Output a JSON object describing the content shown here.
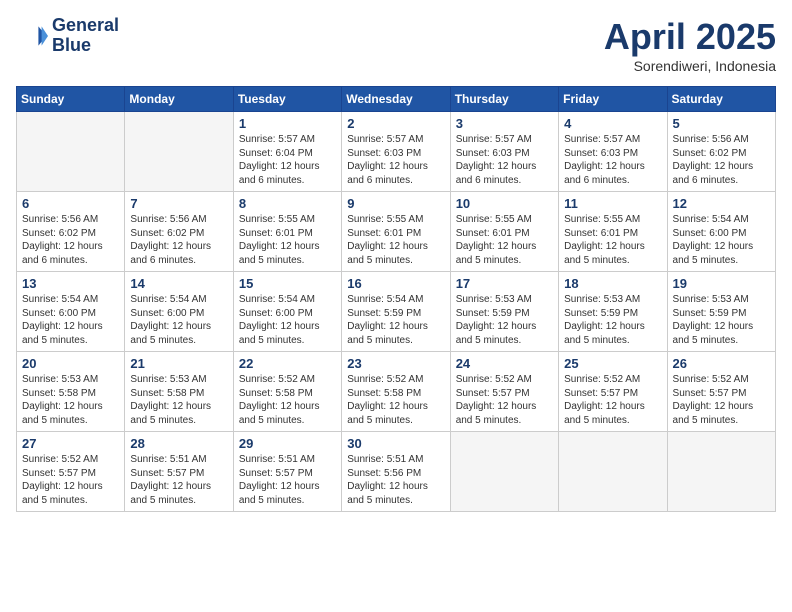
{
  "header": {
    "logo_line1": "General",
    "logo_line2": "Blue",
    "month": "April 2025",
    "location": "Sorendiweri, Indonesia"
  },
  "days_of_week": [
    "Sunday",
    "Monday",
    "Tuesday",
    "Wednesday",
    "Thursday",
    "Friday",
    "Saturday"
  ],
  "weeks": [
    [
      {
        "num": "",
        "info": ""
      },
      {
        "num": "",
        "info": ""
      },
      {
        "num": "1",
        "info": "Sunrise: 5:57 AM\nSunset: 6:04 PM\nDaylight: 12 hours\nand 6 minutes."
      },
      {
        "num": "2",
        "info": "Sunrise: 5:57 AM\nSunset: 6:03 PM\nDaylight: 12 hours\nand 6 minutes."
      },
      {
        "num": "3",
        "info": "Sunrise: 5:57 AM\nSunset: 6:03 PM\nDaylight: 12 hours\nand 6 minutes."
      },
      {
        "num": "4",
        "info": "Sunrise: 5:57 AM\nSunset: 6:03 PM\nDaylight: 12 hours\nand 6 minutes."
      },
      {
        "num": "5",
        "info": "Sunrise: 5:56 AM\nSunset: 6:02 PM\nDaylight: 12 hours\nand 6 minutes."
      }
    ],
    [
      {
        "num": "6",
        "info": "Sunrise: 5:56 AM\nSunset: 6:02 PM\nDaylight: 12 hours\nand 6 minutes."
      },
      {
        "num": "7",
        "info": "Sunrise: 5:56 AM\nSunset: 6:02 PM\nDaylight: 12 hours\nand 6 minutes."
      },
      {
        "num": "8",
        "info": "Sunrise: 5:55 AM\nSunset: 6:01 PM\nDaylight: 12 hours\nand 5 minutes."
      },
      {
        "num": "9",
        "info": "Sunrise: 5:55 AM\nSunset: 6:01 PM\nDaylight: 12 hours\nand 5 minutes."
      },
      {
        "num": "10",
        "info": "Sunrise: 5:55 AM\nSunset: 6:01 PM\nDaylight: 12 hours\nand 5 minutes."
      },
      {
        "num": "11",
        "info": "Sunrise: 5:55 AM\nSunset: 6:01 PM\nDaylight: 12 hours\nand 5 minutes."
      },
      {
        "num": "12",
        "info": "Sunrise: 5:54 AM\nSunset: 6:00 PM\nDaylight: 12 hours\nand 5 minutes."
      }
    ],
    [
      {
        "num": "13",
        "info": "Sunrise: 5:54 AM\nSunset: 6:00 PM\nDaylight: 12 hours\nand 5 minutes."
      },
      {
        "num": "14",
        "info": "Sunrise: 5:54 AM\nSunset: 6:00 PM\nDaylight: 12 hours\nand 5 minutes."
      },
      {
        "num": "15",
        "info": "Sunrise: 5:54 AM\nSunset: 6:00 PM\nDaylight: 12 hours\nand 5 minutes."
      },
      {
        "num": "16",
        "info": "Sunrise: 5:54 AM\nSunset: 5:59 PM\nDaylight: 12 hours\nand 5 minutes."
      },
      {
        "num": "17",
        "info": "Sunrise: 5:53 AM\nSunset: 5:59 PM\nDaylight: 12 hours\nand 5 minutes."
      },
      {
        "num": "18",
        "info": "Sunrise: 5:53 AM\nSunset: 5:59 PM\nDaylight: 12 hours\nand 5 minutes."
      },
      {
        "num": "19",
        "info": "Sunrise: 5:53 AM\nSunset: 5:59 PM\nDaylight: 12 hours\nand 5 minutes."
      }
    ],
    [
      {
        "num": "20",
        "info": "Sunrise: 5:53 AM\nSunset: 5:58 PM\nDaylight: 12 hours\nand 5 minutes."
      },
      {
        "num": "21",
        "info": "Sunrise: 5:53 AM\nSunset: 5:58 PM\nDaylight: 12 hours\nand 5 minutes."
      },
      {
        "num": "22",
        "info": "Sunrise: 5:52 AM\nSunset: 5:58 PM\nDaylight: 12 hours\nand 5 minutes."
      },
      {
        "num": "23",
        "info": "Sunrise: 5:52 AM\nSunset: 5:58 PM\nDaylight: 12 hours\nand 5 minutes."
      },
      {
        "num": "24",
        "info": "Sunrise: 5:52 AM\nSunset: 5:57 PM\nDaylight: 12 hours\nand 5 minutes."
      },
      {
        "num": "25",
        "info": "Sunrise: 5:52 AM\nSunset: 5:57 PM\nDaylight: 12 hours\nand 5 minutes."
      },
      {
        "num": "26",
        "info": "Sunrise: 5:52 AM\nSunset: 5:57 PM\nDaylight: 12 hours\nand 5 minutes."
      }
    ],
    [
      {
        "num": "27",
        "info": "Sunrise: 5:52 AM\nSunset: 5:57 PM\nDaylight: 12 hours\nand 5 minutes."
      },
      {
        "num": "28",
        "info": "Sunrise: 5:51 AM\nSunset: 5:57 PM\nDaylight: 12 hours\nand 5 minutes."
      },
      {
        "num": "29",
        "info": "Sunrise: 5:51 AM\nSunset: 5:57 PM\nDaylight: 12 hours\nand 5 minutes."
      },
      {
        "num": "30",
        "info": "Sunrise: 5:51 AM\nSunset: 5:56 PM\nDaylight: 12 hours\nand 5 minutes."
      },
      {
        "num": "",
        "info": ""
      },
      {
        "num": "",
        "info": ""
      },
      {
        "num": "",
        "info": ""
      }
    ]
  ]
}
